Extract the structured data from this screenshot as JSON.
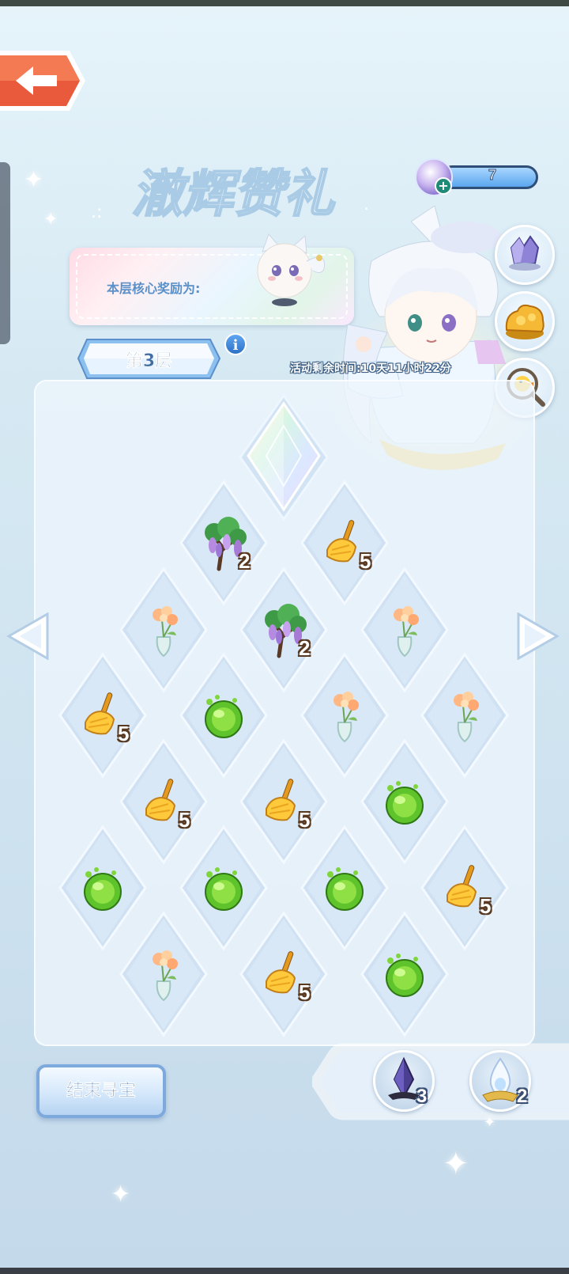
{
  "header": {
    "title": "澈辉赞礼",
    "back_icon": "back-arrow-icon",
    "currency": {
      "icon": "crystal-orb-icon",
      "value": "7"
    }
  },
  "reward": {
    "label": "本层核心奖励为:",
    "pet_icon": "white-cat-pet-icon"
  },
  "floor": {
    "label": "第3层",
    "info_icon": "info-icon"
  },
  "timer": "活动剩余时间:10天11小时22分",
  "side_buttons": [
    {
      "icon": "purple-crystal-icon"
    },
    {
      "icon": "golden-treasure-icon"
    },
    {
      "icon": "magnifier-duck-icon"
    }
  ],
  "board": {
    "top_tile": {
      "icon": "rainbow-crystal-icon"
    },
    "tiles": [
      {
        "icon": "wisteria-tree-icon",
        "count": "2"
      },
      {
        "icon": "broom-icon",
        "count": "5"
      },
      {
        "icon": "flower-vase-icon",
        "count": ""
      },
      {
        "icon": "wisteria-tree-icon",
        "count": "2"
      },
      {
        "icon": "flower-vase-icon",
        "count": ""
      },
      {
        "icon": "broom-icon",
        "count": "5"
      },
      {
        "icon": "green-orb-icon",
        "count": ""
      },
      {
        "icon": "flower-vase-icon",
        "count": ""
      },
      {
        "icon": "flower-vase-icon",
        "count": ""
      },
      {
        "icon": "broom-icon",
        "count": "5"
      },
      {
        "icon": "broom-icon",
        "count": "5"
      },
      {
        "icon": "green-orb-icon",
        "count": ""
      },
      {
        "icon": "green-orb-icon",
        "count": ""
      },
      {
        "icon": "green-orb-icon",
        "count": ""
      },
      {
        "icon": "green-orb-icon",
        "count": ""
      },
      {
        "icon": "broom-icon",
        "count": "5"
      },
      {
        "icon": "flower-vase-icon",
        "count": ""
      },
      {
        "icon": "broom-icon",
        "count": "5"
      },
      {
        "icon": "green-orb-icon",
        "count": ""
      }
    ]
  },
  "nav": {
    "prev_icon": "left-arrow-icon",
    "next_icon": "right-arrow-icon"
  },
  "end_button": {
    "label": "结束寻宝"
  },
  "inventory": [
    {
      "icon": "dark-crystal-icon",
      "count": "3"
    },
    {
      "icon": "light-crystal-icon",
      "count": "2"
    }
  ]
}
